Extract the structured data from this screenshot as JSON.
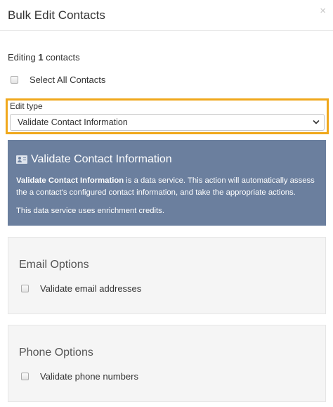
{
  "header": {
    "title": "Bulk Edit Contacts",
    "close_glyph": "×"
  },
  "editing": {
    "prefix": "Editing ",
    "count": "1",
    "suffix": " contacts"
  },
  "select_all": {
    "label": "Select All Contacts",
    "checked": false
  },
  "edit_type": {
    "label": "Edit type",
    "selected": "Validate Contact Information",
    "highlight_color": "#f0a81c"
  },
  "info_panel": {
    "title": "Validate Contact Information",
    "icon": "contact-card-icon",
    "desc_bold": "Validate Contact Information",
    "desc_rest": " is a data service. This action will automatically assess the a contact's configured contact information, and take the appropriate actions.",
    "note": "This data service uses enrichment credits.",
    "background": "#6b7f9e"
  },
  "email_options": {
    "title": "Email Options",
    "checkbox_label": "Validate email addresses",
    "checked": false
  },
  "phone_options": {
    "title": "Phone Options",
    "checkbox_label": "Validate phone numbers",
    "checked": false
  }
}
